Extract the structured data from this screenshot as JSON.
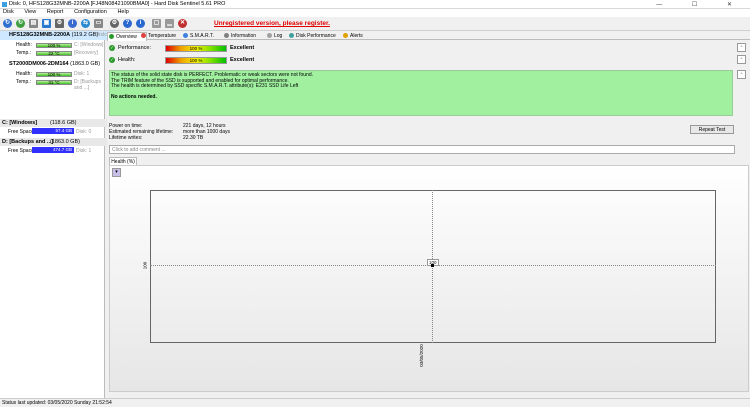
{
  "window": {
    "title": "Disk: 0, HFS128G32MNB-2200A [FJ48N08421090BMA0]  -  Hard Disk Sentinel 5.61 PRO"
  },
  "menu": [
    "Disk",
    "View",
    "Report",
    "Configuration",
    "Help"
  ],
  "toolbar": {
    "warning": "Unregistered version, please register."
  },
  "disks": [
    {
      "name": "HFS128G32MNB-2200A",
      "size": "(119.2 GB)",
      "disk_label": "Disk: 0",
      "health_label": "Health:",
      "health": "100 %",
      "health_vol": "C: [Windows]",
      "temp_label": "Temp.:",
      "temp": "22 °C",
      "temp_vol": "[Recovery]"
    },
    {
      "name": "ST2000DM006-2DM164",
      "size": "(1863.0 GB)",
      "disk_label": "",
      "health_label": "Health:",
      "health": "100 %",
      "health_vol": "Disk: 1",
      "temp_label": "Temp.:",
      "temp": "31 °C",
      "temp_vol": "D: [Backups and ...]"
    }
  ],
  "volumes": [
    {
      "name": "C: [Windows]",
      "size": "(118.6 GB)",
      "free_label": "Free Space",
      "free": "57.4 GB",
      "disk": "Disk: 0"
    },
    {
      "name": "D: [Backups and ...]",
      "size": "(1863.0 GB)",
      "free_label": "Free Space",
      "free": "474.7 GB",
      "disk": "Disk: 1"
    }
  ],
  "tabs": [
    "Overview",
    "Temperature",
    "S.M.A.R.T.",
    "Information",
    "Log",
    "Disk Performance",
    "Alerts"
  ],
  "overview": {
    "performance_label": "Performance:",
    "performance_value": "100 %",
    "performance_text": "Excellent",
    "health_label": "Health:",
    "health_value": "100 %",
    "health_text": "Excellent",
    "info_lines": [
      "The status of the solid state disk is PERFECT. Problematic or weak sectors were not found.",
      "The TRIM feature of the SSD is supported and enabled for optimal performance.",
      "The health is determined by SSD specific S.M.A.R.T. attribute(s):  E231 SSD Life Left"
    ],
    "no_actions": "No actions needed.",
    "power_on_label": "Power on time:",
    "power_on": "221 days, 12 hours",
    "remaining_label": "Estimated remaining lifetime:",
    "remaining": "more than 1000 days",
    "writes_label": "Lifetime writes:",
    "writes": "22.30 TB",
    "repeat_test": "Repeat Test",
    "comment_placeholder": "Click to add comment ..."
  },
  "health_tab": "Health (%)",
  "chart_data": {
    "type": "line",
    "x": [
      "03/05/2020"
    ],
    "series": [
      {
        "values": [
          100
        ]
      }
    ],
    "point_label": "100",
    "ylabel_tick": "100"
  },
  "status": "Status last updated: 03/05/2020 Sunday 21:52:54"
}
